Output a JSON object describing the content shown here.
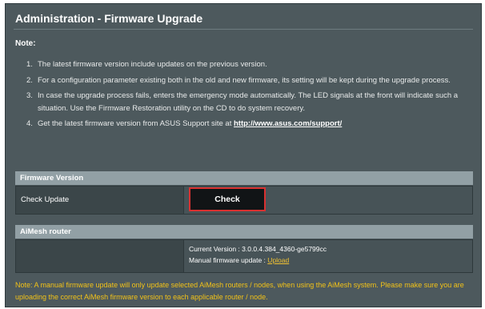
{
  "page": {
    "title": "Administration - Firmware Upgrade",
    "note_label": "Note:"
  },
  "notes": [
    {
      "num": "1.",
      "text": "The latest firmware version include updates on the previous version."
    },
    {
      "num": "2.",
      "text": "For a configuration parameter existing both in the old and new firmware, its setting will be kept during the upgrade process."
    },
    {
      "num": "3.",
      "text": "In case the upgrade process fails, enters the emergency mode automatically. The LED signals at the front will indicate such a situation. Use the Firmware Restoration utility on the CD to do system recovery."
    },
    {
      "num": "4.",
      "text": "Get the latest firmware version from ASUS Support site at ",
      "link": "http://www.asus.com/support/"
    }
  ],
  "firmware_version": {
    "header": "Firmware Version",
    "check_update_label": "Check Update",
    "check_button": "Check"
  },
  "aimesh": {
    "header": "AiMesh router",
    "current_version": "Current Version : 3.0.0.4.384_4360-ge5799cc",
    "manual_update_label": "Manual firmware update : ",
    "upload_link": "Upload"
  },
  "footer_note": "Note: A manual firmware update will only update selected AiMesh routers / nodes, when using the AiMesh system. Please make sure you are uploading the correct AiMesh firmware version to each applicable router / node.",
  "colors": {
    "panel": "#4d595d",
    "section_header": "#92a0a5",
    "highlight": "#d93030",
    "warning_text": "#f2c218",
    "link_yellow": "#f1c232"
  }
}
